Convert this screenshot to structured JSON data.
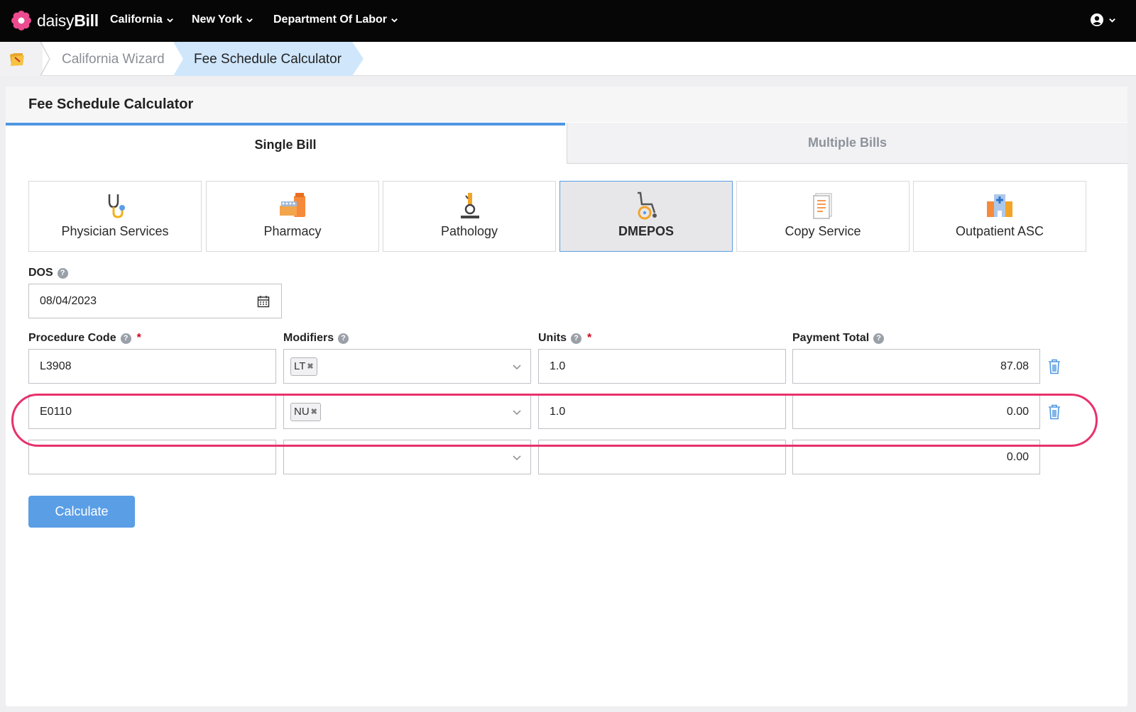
{
  "brand": {
    "name_light": "daisy",
    "name_bold": "Bill"
  },
  "nav": {
    "items": [
      {
        "label": "California"
      },
      {
        "label": "New York"
      },
      {
        "label": "Department Of Labor"
      }
    ]
  },
  "breadcrumb": {
    "items": [
      {
        "label": "California Wizard"
      },
      {
        "label": "Fee Schedule Calculator"
      }
    ]
  },
  "panel": {
    "title": "Fee Schedule Calculator"
  },
  "tabs": [
    {
      "label": "Single Bill",
      "active": true
    },
    {
      "label": "Multiple Bills",
      "active": false
    }
  ],
  "services": [
    {
      "label": "Physician Services",
      "icon": "stethoscope-icon"
    },
    {
      "label": "Pharmacy",
      "icon": "pharmacy-icon"
    },
    {
      "label": "Pathology",
      "icon": "microscope-icon"
    },
    {
      "label": "DMEPOS",
      "icon": "wheelchair-icon",
      "active": true
    },
    {
      "label": "Copy Service",
      "icon": "document-icon"
    },
    {
      "label": "Outpatient ASC",
      "icon": "hospital-icon"
    }
  ],
  "form": {
    "dos_label": "DOS",
    "dos_value": "08/04/2023",
    "procedure_label": "Procedure Code",
    "modifiers_label": "Modifiers",
    "units_label": "Units",
    "payment_label": "Payment Total",
    "required_mark": "*",
    "help_mark": "?",
    "rows": [
      {
        "procedure": "L3908",
        "modifier": "LT",
        "units": "1.0",
        "payment": "87.08"
      },
      {
        "procedure": "E0110",
        "modifier": "NU",
        "units": "1.0",
        "payment": "0.00"
      },
      {
        "procedure": "",
        "modifier": "",
        "units": "",
        "payment": "0.00"
      }
    ],
    "tag_remove": "✖",
    "calculate_label": "Calculate"
  },
  "colors": {
    "accent": "#5a9ee6",
    "highlight": "#e8316b",
    "nav_bg": "#060606",
    "crumb_active": "#cfe6fb"
  }
}
